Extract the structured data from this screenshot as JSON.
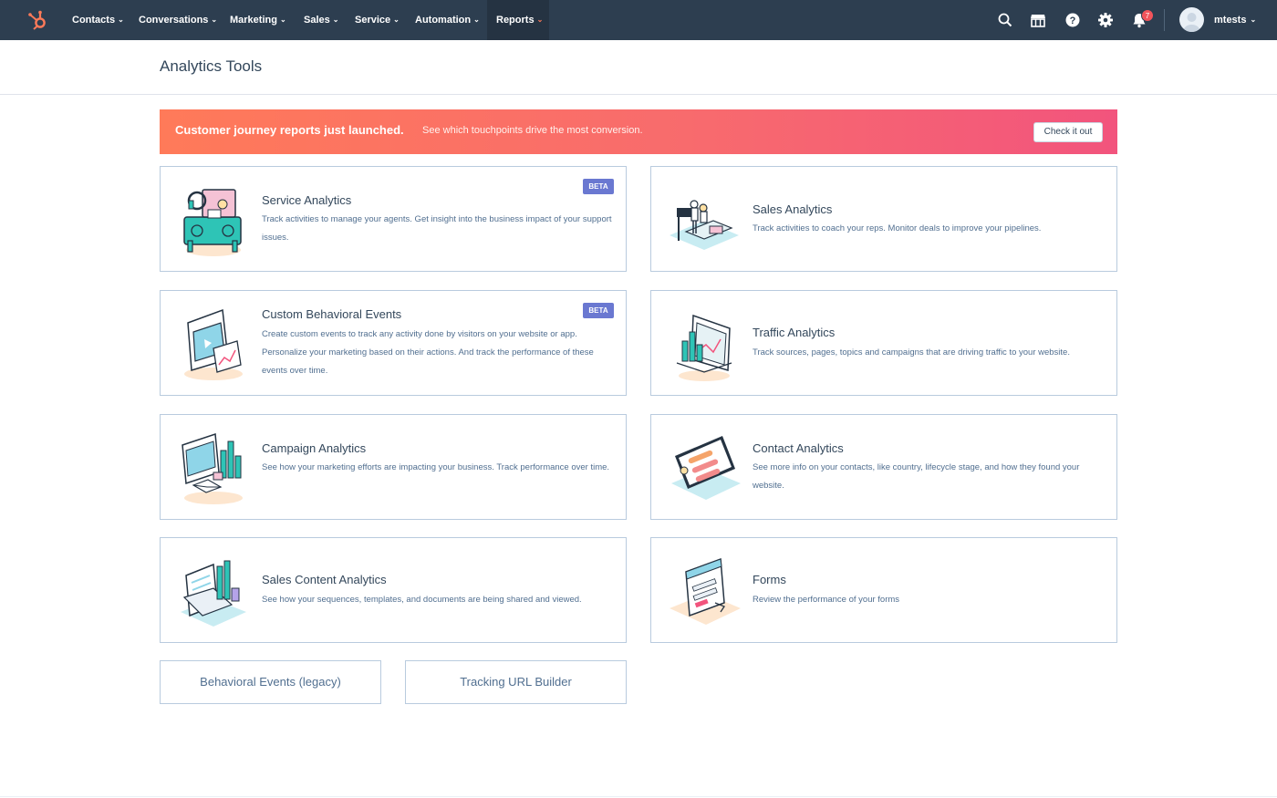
{
  "nav": {
    "logo_icon": "hubspot-sprocket-icon",
    "items": [
      {
        "label": "Contacts"
      },
      {
        "label": "Conversations"
      },
      {
        "label": "Marketing"
      },
      {
        "label": "Sales"
      },
      {
        "label": "Service"
      },
      {
        "label": "Automation"
      },
      {
        "label": "Reports"
      }
    ],
    "chevron": "⌄",
    "active_item": "Reports",
    "icons": [
      "search-icon",
      "marketplace-icon",
      "help-icon",
      "gear-icon",
      "bell-icon"
    ],
    "notification_count": "7",
    "username": "mtests",
    "colors": {
      "nav_bg": "#2d3e50",
      "accent": "#ff7a59",
      "badge": "#f2545b"
    }
  },
  "page": {
    "title": "Analytics Tools"
  },
  "banner": {
    "title": "Customer journey reports just launched.",
    "text": "See which touchpoints drive the most conversion.",
    "button": "Check it out"
  },
  "cards": [
    {
      "title": "Service Analytics",
      "description": "Track activities to manage your agents. Get insight into the business impact of your support issues.",
      "badge": "BETA",
      "icon": "service-desk-illustration"
    },
    {
      "title": "Sales Analytics",
      "description": "Track activities to coach your reps. Monitor deals to improve your pipelines.",
      "badge": "",
      "icon": "sales-team-illustration"
    },
    {
      "title": "Custom Behavioral Events",
      "description": "Create custom events to track any activity done by visitors on your website or app. Personalize your marketing based on their actions. And track the performance of these events over time.",
      "badge": "BETA",
      "icon": "video-browser-illustration"
    },
    {
      "title": "Traffic Analytics",
      "description": "Track sources, pages, topics and campaigns that are driving traffic to your website.",
      "badge": "",
      "icon": "traffic-chart-illustration"
    },
    {
      "title": "Campaign Analytics",
      "description": "See how your marketing efforts are impacting your business. Track performance over time.",
      "badge": "",
      "icon": "campaign-illustration"
    },
    {
      "title": "Contact Analytics",
      "description": "See more info on your contacts, like country, lifecycle stage, and how they found your website.",
      "badge": "",
      "icon": "contact-cards-illustration"
    },
    {
      "title": "Sales Content Analytics",
      "description": "See how your sequences, templates, and documents are being shared and viewed.",
      "badge": "",
      "icon": "email-documents-illustration"
    },
    {
      "title": "Forms",
      "description": "Review the performance of your forms",
      "badge": "",
      "icon": "form-illustration"
    }
  ],
  "links": [
    {
      "label": "Behavioral Events (legacy)"
    },
    {
      "label": "Tracking URL Builder"
    }
  ]
}
